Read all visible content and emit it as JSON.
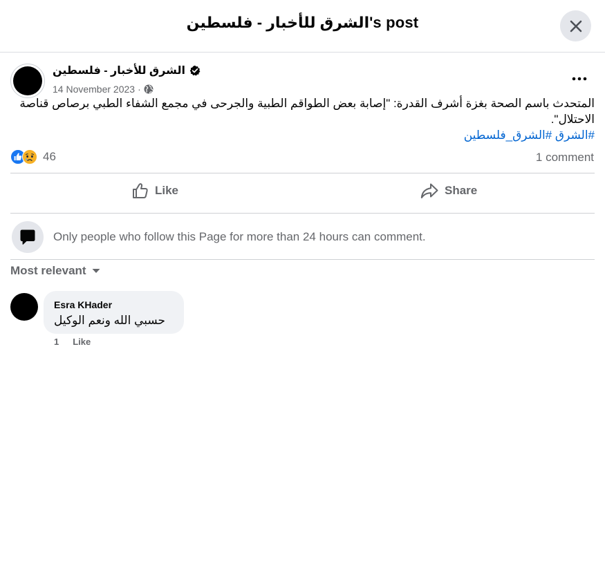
{
  "header": {
    "title": "الشرق للأخبار - فلسطين's post"
  },
  "post": {
    "page_name": "الشرق للأخبار - فلسطين",
    "date": "14 November 2023",
    "separator": "·",
    "text": "المتحدث باسم الصحة بغزة أشرف القدرة: \"إصابة بعض الطواقم الطبية والجرحى في مجمع الشفاء الطبي برصاص قناصة الاحتلال\".",
    "hashtags": [
      "#الشرق",
      "#الشرق_فلسطين"
    ],
    "reaction_count": "46",
    "comment_count": "1 comment",
    "icons": {
      "verified": "verified-badge-icon",
      "privacy": "globe-icon",
      "more": "more-options-icon",
      "reactions": [
        "like-reaction-icon",
        "sad-reaction-icon"
      ]
    }
  },
  "actions": {
    "like_label": "Like",
    "share_label": "Share"
  },
  "comments_section": {
    "restriction_text": "Only people who follow this Page for more than 24 hours can comment.",
    "sort_label": "Most relevant",
    "comments": [
      {
        "author": "Esra KHader",
        "text": "حسبي الله ونعم الوكيل",
        "time": "1",
        "like_label": "Like"
      }
    ]
  },
  "colors": {
    "accent_link": "#0064d1",
    "like_blue": "#1877f2",
    "secondary_text": "#65676b",
    "bubble": "#f0f2f5"
  }
}
